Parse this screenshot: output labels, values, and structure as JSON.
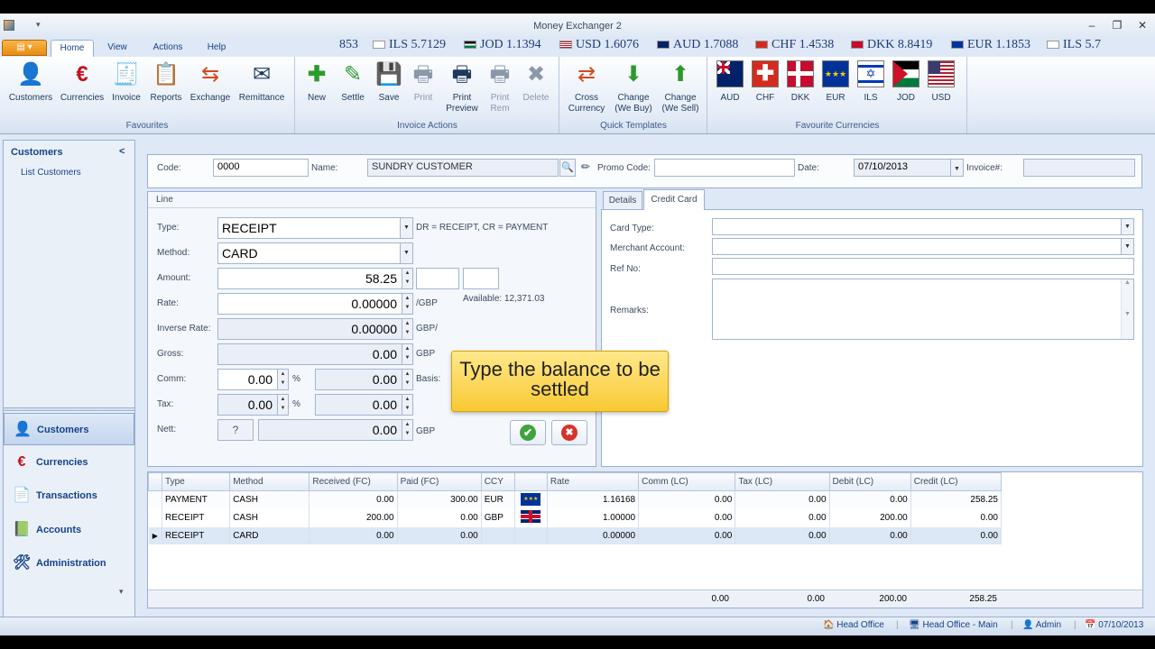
{
  "window": {
    "title": "Money Exchanger 2"
  },
  "ribbon_tabs": [
    "Home",
    "View",
    "Actions",
    "Help"
  ],
  "rates": [
    "853",
    "ILS 5.7129",
    "JOD 1.1394",
    "USD 1.6076",
    "AUD 1.7088",
    "CHF 1.4538",
    "DKK 8.8419",
    "EUR 1.1853",
    "ILS 5.7"
  ],
  "groups": {
    "favourites": {
      "label": "Favourites",
      "buttons": [
        "Customers",
        "Currencies",
        "Invoice",
        "Reports",
        "Exchange",
        "Remittance"
      ]
    },
    "invoice_actions": {
      "label": "Invoice Actions",
      "buttons": [
        "New",
        "Settle",
        "Save",
        "Print",
        "Print\nPreview",
        "Print\nRem",
        "Delete"
      ]
    },
    "quick_templates": {
      "label": "Quick Templates",
      "buttons": [
        "Cross\nCurrency",
        "Change\n(We Buy)",
        "Change\n(We Sell)"
      ]
    },
    "favourite_currencies": {
      "label": "Favourite Currencies",
      "buttons": [
        "AUD",
        "CHF",
        "DKK",
        "EUR",
        "ILS",
        "JOD",
        "USD"
      ]
    }
  },
  "colors": {
    "accent": "#f5a32a",
    "nav_text": "#15428b",
    "grid_selected": "#dde8f6",
    "callout": "#fbd34e"
  },
  "nav": {
    "header": "Customers",
    "collapse": "<",
    "sub_item": "List Customers",
    "buttons": [
      "Customers",
      "Currencies",
      "Transactions",
      "Accounts",
      "Administration"
    ]
  },
  "form": {
    "code_label": "Code:",
    "code": "0000",
    "name_label": "Name:",
    "name": "SUNDRY CUSTOMER",
    "promo_label": "Promo Code:",
    "promo": "",
    "date_label": "Date:",
    "date": "07/10/2013",
    "invoice_label": "Invoice#:",
    "invoice": ""
  },
  "line": {
    "title": "Line",
    "type_label": "Type:",
    "type": "RECEIPT",
    "type_hint": "DR = RECEIPT, CR = PAYMENT",
    "method_label": "Method:",
    "method": "CARD",
    "amount_label": "Amount:",
    "amount": "58.25",
    "available": "Available: 12,371.03",
    "rate_label": "Rate:",
    "rate": "0.00000",
    "rate_unit": "/GBP",
    "inverse_label": "Inverse Rate:",
    "inverse": "0.00000",
    "inverse_unit": "GBP/",
    "gross_label": "Gross:",
    "gross": "0.00",
    "gross_unit": "GBP",
    "comm_label": "Comm:",
    "comm_pct": "0.00",
    "comm_amt": "0.00",
    "pct": "%",
    "basis_label": "Basis:",
    "tax_label": "Tax:",
    "tax_pct": "0.00",
    "tax_amt": "0.00",
    "nett_label": "Nett:",
    "nett_btn": "?",
    "nett": "0.00",
    "nett_unit": "GBP"
  },
  "card_tabs": [
    "Details",
    "Credit Card"
  ],
  "card": {
    "card_type_label": "Card Type:",
    "merchant_label": "Merchant Account:",
    "ref_label": "Ref No:",
    "remarks_label": "Remarks:"
  },
  "callout": "Type the balance to be settled",
  "grid": {
    "columns": [
      "Type",
      "Method",
      "Received (FC)",
      "Paid (FC)",
      "CCY",
      "",
      "Rate",
      "Comm (LC)",
      "Tax (LC)",
      "Debit (LC)",
      "Credit (LC)"
    ],
    "rows": [
      [
        "PAYMENT",
        "CASH",
        "0.00",
        "300.00",
        "EUR",
        "eu-flag",
        "1.16168",
        "0.00",
        "0.00",
        "0.00",
        "258.25"
      ],
      [
        "RECEIPT",
        "CASH",
        "200.00",
        "0.00",
        "GBP",
        "uk-flag",
        "1.00000",
        "0.00",
        "0.00",
        "200.00",
        "0.00"
      ],
      [
        "RECEIPT",
        "CARD",
        "0.00",
        "0.00",
        "",
        "",
        "0.00000",
        "0.00",
        "0.00",
        "0.00",
        "0.00"
      ]
    ],
    "totals": [
      "0.00",
      "0.00",
      "200.00",
      "258.25"
    ]
  },
  "status": {
    "office": "Head Office",
    "branch": "Head Office - Main",
    "user": "Admin",
    "date": "07/10/2013"
  }
}
